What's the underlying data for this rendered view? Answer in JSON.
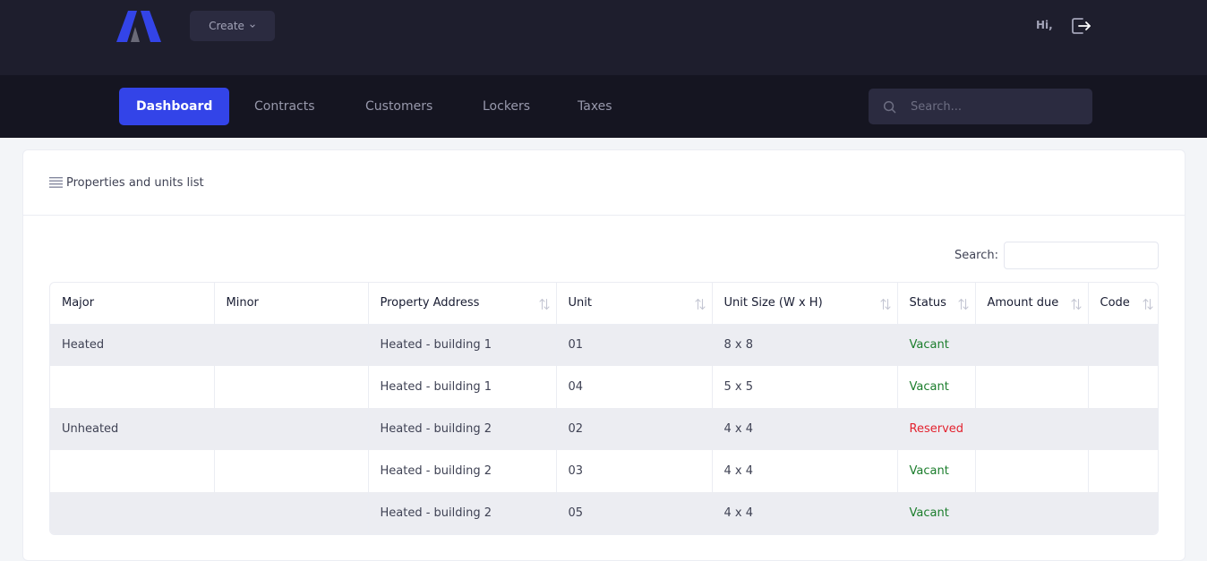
{
  "header": {
    "create_label": "Create",
    "greeting": "Hi,"
  },
  "nav": {
    "items": [
      {
        "label": "Dashboard",
        "active": true
      },
      {
        "label": "Contracts"
      },
      {
        "label": "Customers"
      },
      {
        "label": "Lockers"
      },
      {
        "label": "Taxes"
      }
    ],
    "search_placeholder": "Search..."
  },
  "card": {
    "title": "Properties and units list",
    "search_label": "Search:",
    "search_value": ""
  },
  "table": {
    "columns": [
      "Major",
      "Minor",
      "Property Address",
      "Unit",
      "Unit Size (W x H)",
      "Status",
      "Amount due",
      "Code"
    ],
    "rows": [
      {
        "major": "Heated",
        "minor": "",
        "address": "Heated - building 1",
        "unit": "01",
        "size": "8 x 8",
        "status": "Vacant",
        "amount": "",
        "code": ""
      },
      {
        "major": "",
        "minor": "",
        "address": "Heated - building 1",
        "unit": "04",
        "size": "5 x 5",
        "status": "Vacant",
        "amount": "",
        "code": ""
      },
      {
        "major": "Unheated",
        "minor": "",
        "address": "Heated - building 2",
        "unit": "02",
        "size": "4 x 4",
        "status": "Reserved",
        "amount": "",
        "code": ""
      },
      {
        "major": "",
        "minor": "",
        "address": "Heated - building 2",
        "unit": "03",
        "size": "4 x 4",
        "status": "Vacant",
        "amount": "",
        "code": ""
      },
      {
        "major": "",
        "minor": "",
        "address": "Heated - building 2",
        "unit": "05",
        "size": "4 x 4",
        "status": "Vacant",
        "amount": "",
        "code": ""
      }
    ]
  },
  "colors": {
    "accent": "#3344e8",
    "header_bg": "#1e1e2d",
    "nav_bg": "#151521",
    "vacant": "#1b7d2c",
    "reserved": "#e3222f"
  }
}
